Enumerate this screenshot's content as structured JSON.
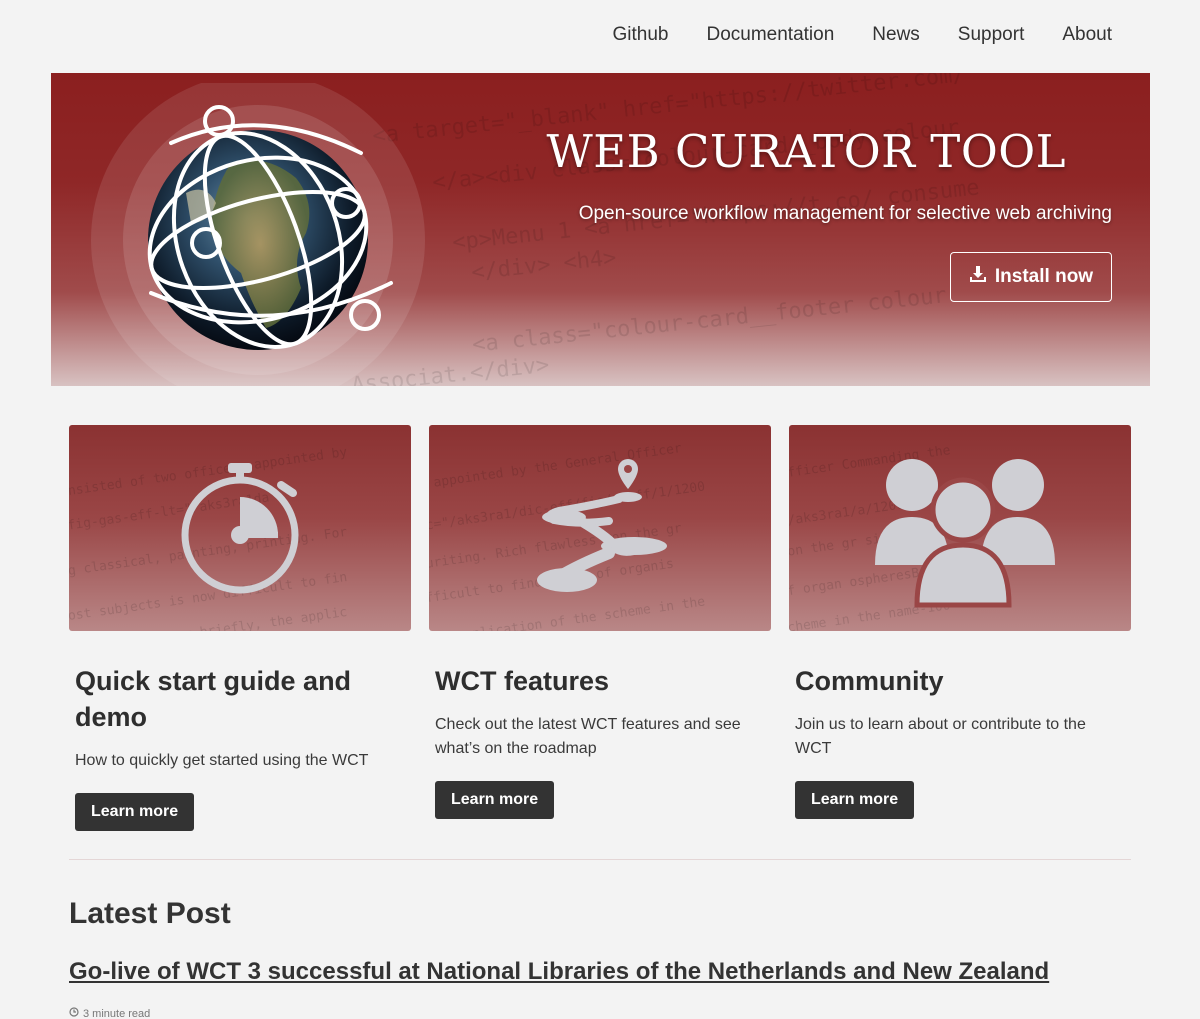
{
  "nav": {
    "items": [
      {
        "label": "Github"
      },
      {
        "label": "Documentation"
      },
      {
        "label": "News"
      },
      {
        "label": "Support"
      },
      {
        "label": "About"
      }
    ]
  },
  "hero": {
    "title": "WEB CURATOR TOOL",
    "subtitle": "Open-source workflow management for selective web archiving",
    "install_label": "Install now",
    "install_icon": "download-icon",
    "logo_icon": "globe-logo-icon"
  },
  "cards": [
    {
      "title": "Quick start guide and demo",
      "description": "How to quickly get started using the WCT",
      "button": "Learn more",
      "icon": "stopwatch-icon"
    },
    {
      "title": "WCT features",
      "description": "Check out the latest WCT features and see what’s on the roadmap",
      "button": "Learn more",
      "icon": "roadmap-path-icon"
    },
    {
      "title": "Community",
      "description": "Join us to learn about or contribute to the WCT",
      "button": "Learn more",
      "icon": "group-people-icon"
    }
  ],
  "latest": {
    "heading": "Latest Post",
    "post_title": "Go-live of WCT 3 successful at National Libraries of the Netherlands and New Zealand",
    "read_time": "3 minute read",
    "read_icon": "clock-icon"
  },
  "colors": {
    "hero_red": "#8b1f1f",
    "button_dark": "#333333",
    "icon_gray": "#cfcfd4"
  }
}
